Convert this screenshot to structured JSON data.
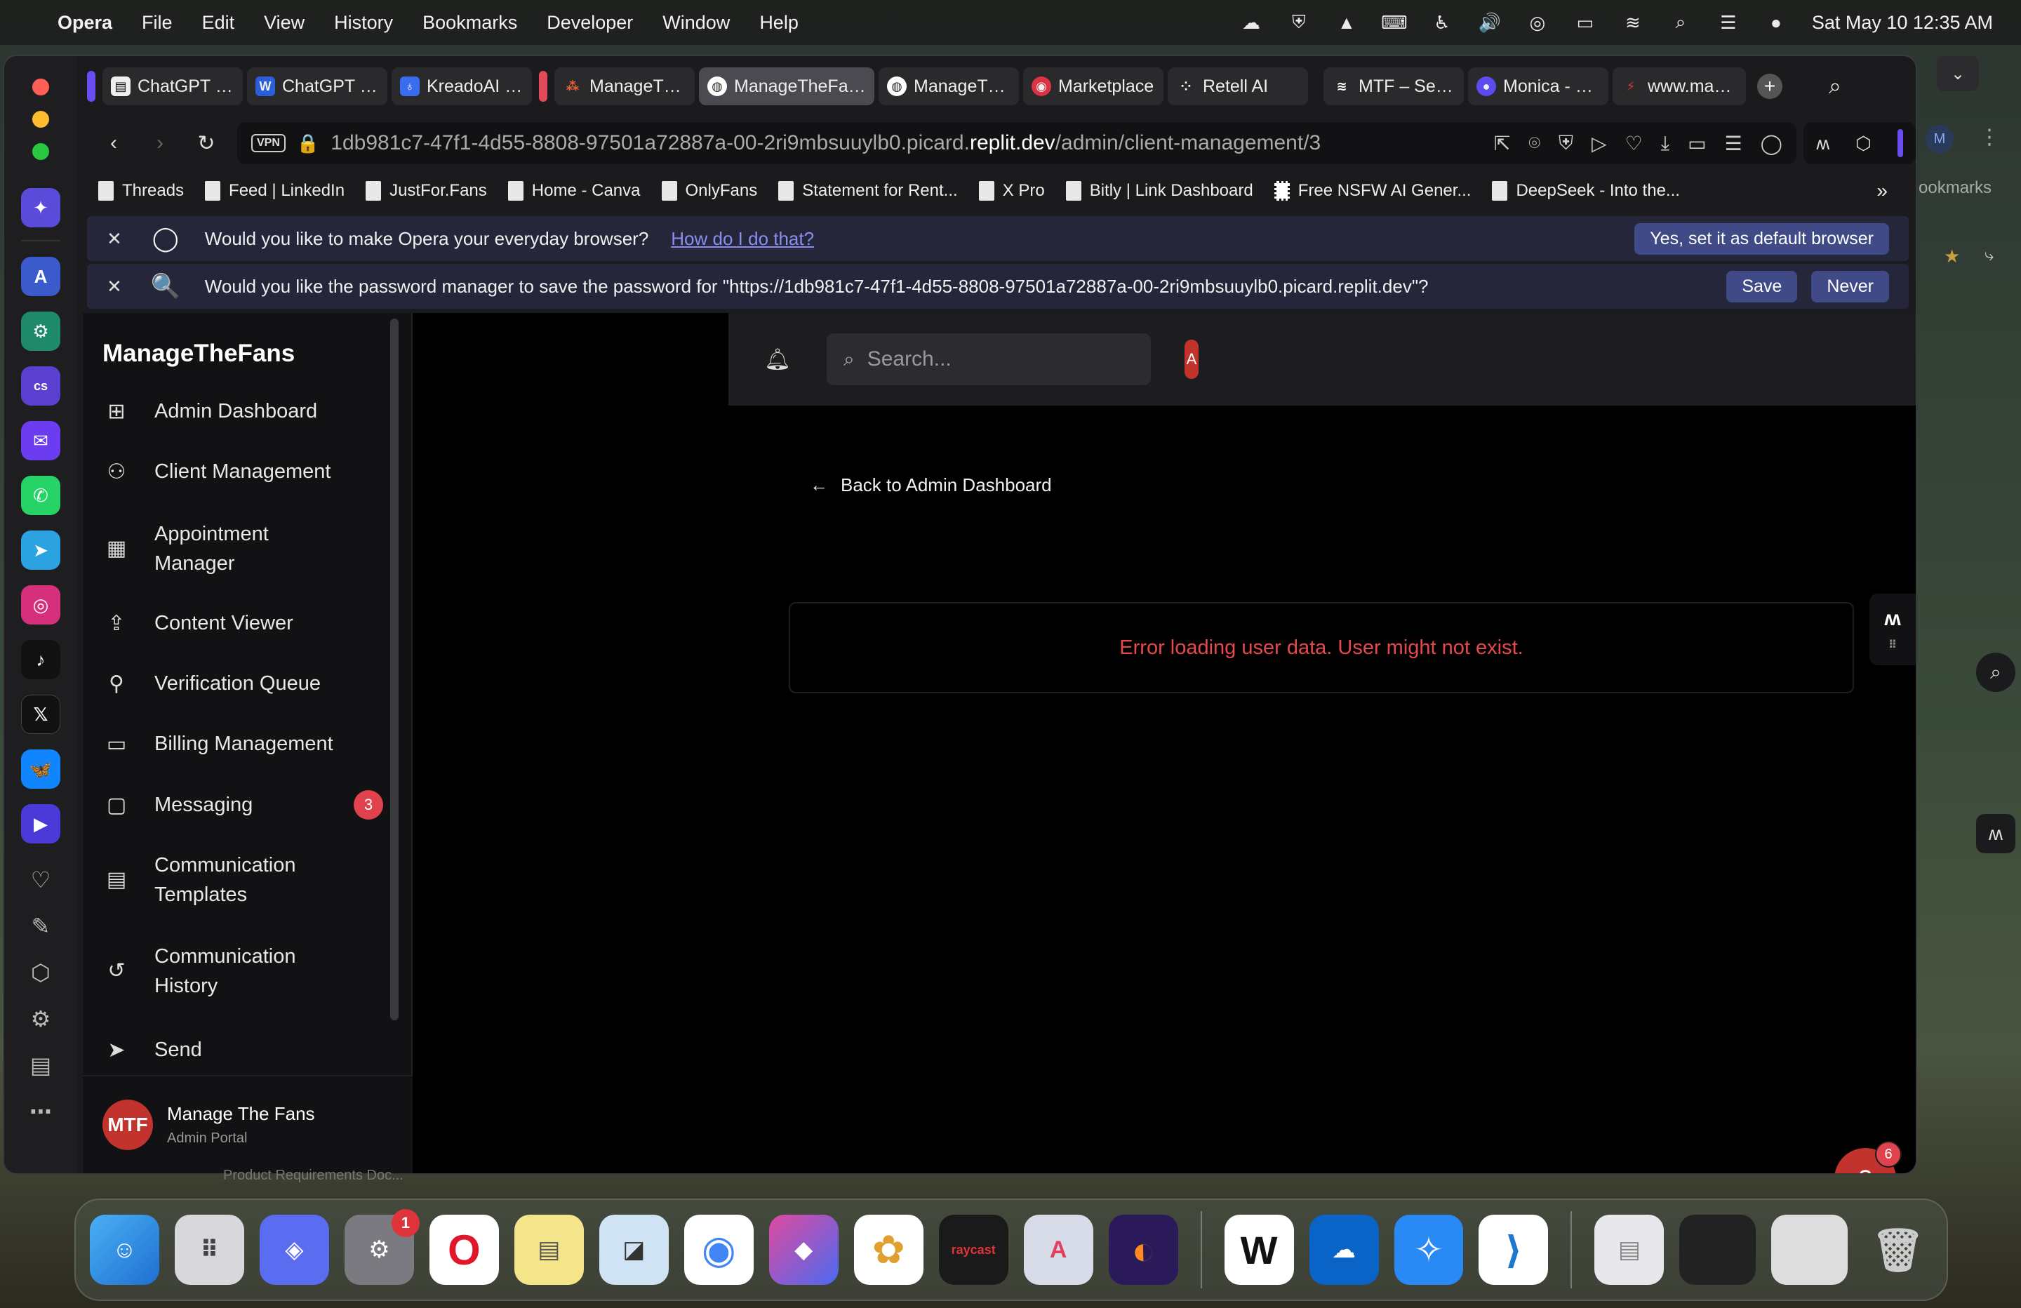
{
  "menubar": {
    "app_name": "Opera",
    "items": [
      "File",
      "Edit",
      "View",
      "History",
      "Bookmarks",
      "Developer",
      "Window",
      "Help"
    ],
    "datetime": "Sat May 10  12:35 AM"
  },
  "tabs": [
    {
      "label": "ChatGPT Pro",
      "icon": "doc-icon"
    },
    {
      "label": "ChatGPT Pro",
      "icon": "w-icon"
    },
    {
      "label": "KreadoAI - D",
      "icon": "kreado-icon"
    },
    {
      "label": "ManageTheF",
      "icon": "mtf-icon"
    },
    {
      "label": "ManageTheFans Porta",
      "icon": "globe-icon",
      "active": true
    },
    {
      "label": "ManageTheF",
      "icon": "globe-icon"
    },
    {
      "label": "Marketplace",
      "icon": "marketplace-icon"
    },
    {
      "label": "Retell AI",
      "icon": "retell-icon"
    },
    {
      "label": "MTF – Settin",
      "icon": "mtf-icon"
    },
    {
      "label": "Monica - Cha",
      "icon": "monica-icon"
    },
    {
      "label": "www.manag",
      "icon": "bolt-icon"
    }
  ],
  "address": {
    "url_prefix": "1db981c7-47f1-4d55-8808-97501a72887a-00-2ri9mbsuuylb0.picard.",
    "url_domain": "replit.dev",
    "url_path": "/admin/client-management/3",
    "vpn_label": "VPN"
  },
  "bookmarks": [
    "Threads",
    "Feed | LinkedIn",
    "JustFor.Fans",
    "Home - Canva",
    "OnlyFans",
    "Statement for Rent...",
    "X Pro",
    "Bitly | Link Dashboard",
    "Free NSFW AI Gener...",
    "DeepSeek - Into the..."
  ],
  "default_browser_prompt": {
    "text": "Would you like to make Opera your everyday browser?",
    "link": "How do I do that?",
    "button": "Yes, set it as default browser"
  },
  "password_prompt": {
    "text": "Would you like the password manager to save the password for \"https://1db981c7-47f1-4d55-8808-97501a72887a-00-2ri9mbsuuylb0.picard.replit.dev\"?",
    "save": "Save",
    "never": "Never"
  },
  "app": {
    "brand": "ManageTheFans",
    "nav": [
      {
        "label": "Admin Dashboard",
        "icon": "grid-icon"
      },
      {
        "label": "Client Management",
        "icon": "users-icon"
      },
      {
        "label": "Appointment Manager",
        "icon": "calendar-icon"
      },
      {
        "label": "Content Viewer",
        "icon": "upload-icon"
      },
      {
        "label": "Verification Queue",
        "icon": "user-plus-icon"
      },
      {
        "label": "Billing Management",
        "icon": "card-icon"
      },
      {
        "label": "Messaging",
        "icon": "message-icon",
        "badge": "3"
      },
      {
        "label": "Communication Templates",
        "icon": "file-icon"
      },
      {
        "label": "Communication History",
        "icon": "history-icon"
      },
      {
        "label": "Send",
        "icon": "send-icon"
      }
    ],
    "account": {
      "initials": "MTF",
      "name": "Manage The Fans",
      "role": "Admin Portal"
    },
    "search_placeholder": "Search...",
    "user_initial": "A",
    "back_link": "Back to Admin Dashboard",
    "error_message": "Error loading user data. User might not exist.",
    "help_badge": "6"
  },
  "outside": {
    "bookmarks_label": "ookmarks",
    "profile_initial": "M",
    "footer_text": "Product Requirements Doc..."
  },
  "dock_badge": "1"
}
